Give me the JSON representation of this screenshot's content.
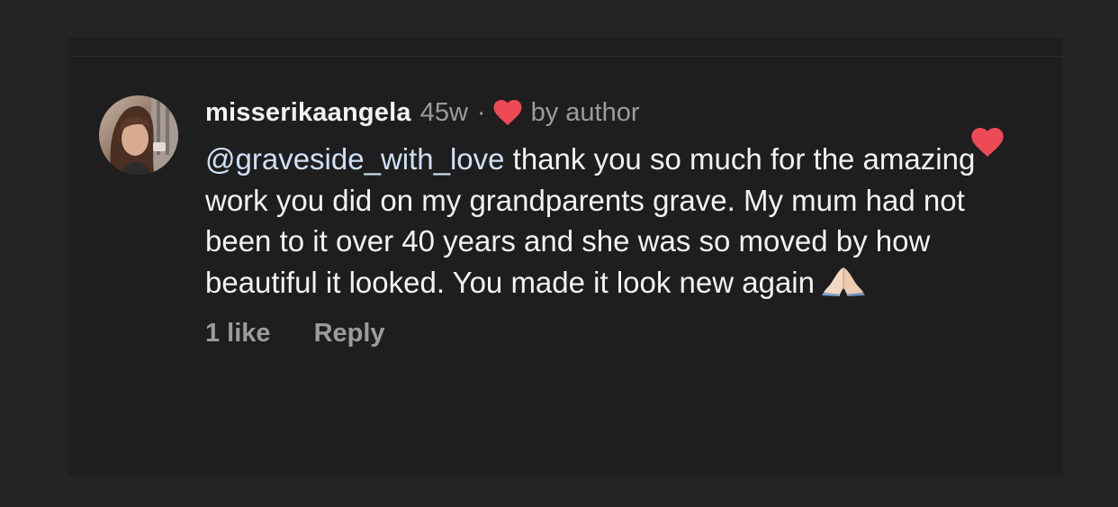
{
  "comment": {
    "username": "misserikaangela",
    "time_ago": "45w",
    "separator": "·",
    "by_author": "by author",
    "mention": "@graveside_with_love",
    "text": " thank you so much for the amazing work you did on my grandparents grave. My mum had not been to it over 40 years and she was so moved by how beautiful it looked. You made it look new again",
    "emoji": "folded-hands-emoji",
    "likes": "1 like",
    "reply": "Reply",
    "liked": true
  },
  "colors": {
    "heart": "#ed4956",
    "mention": "#cfe0f5",
    "text": "#f2f2f2",
    "secondary": "#9c9c9c",
    "card_background": "#1e1e1e",
    "page_background": "#242424"
  }
}
